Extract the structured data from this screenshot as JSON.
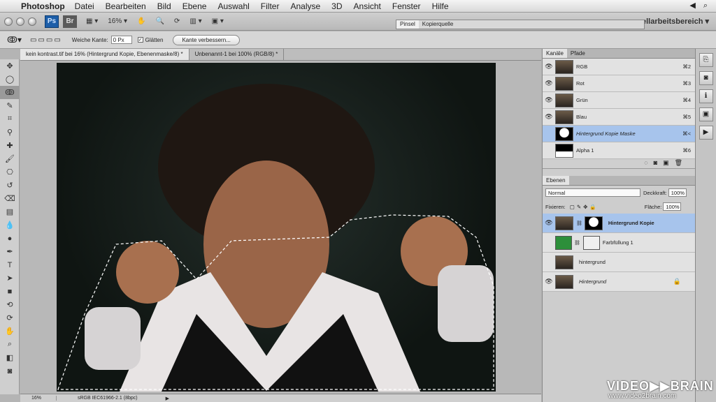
{
  "menubar": {
    "app_name": "Photoshop",
    "items": [
      "Datei",
      "Bearbeiten",
      "Bild",
      "Ebene",
      "Auswahl",
      "Filter",
      "Analyse",
      "3D",
      "Ansicht",
      "Fenster",
      "Hilfe"
    ]
  },
  "appbar": {
    "zoom": "16%",
    "workspace": "ellarbeitsbereich"
  },
  "floating_panel": {
    "tabs": [
      "Pinsel",
      "Kopierquelle"
    ]
  },
  "options": {
    "feather_label": "Weiche Kante:",
    "feather_value": "0 Px",
    "smooth_label": "Glätten",
    "refine_label": "Kante verbessern..."
  },
  "documents": {
    "tabs": [
      "kein kontrast.tif bei 16% (Hintergrund Kopie, Ebenenmaske/8) *",
      "Unbenannt-1 bei 100% (RGB/8) *"
    ]
  },
  "status": {
    "zoom": "16%",
    "profile": "sRGB IEC61966-2.1 (8bpc)"
  },
  "channels_panel": {
    "tabs": [
      "Kanäle",
      "Pfade"
    ],
    "rows": [
      {
        "name": "RGB",
        "key": "⌘2"
      },
      {
        "name": "Rot",
        "key": "⌘3"
      },
      {
        "name": "Grün",
        "key": "⌘4"
      },
      {
        "name": "Blau",
        "key": "⌘5"
      },
      {
        "name": "Hintergrund Kopie Maske",
        "key": "⌘<"
      },
      {
        "name": "Alpha 1",
        "key": "⌘6"
      }
    ]
  },
  "layers_panel": {
    "tab": "Ebenen",
    "blend_mode": "Normal",
    "opacity_label": "Deckkraft:",
    "opacity_value": "100%",
    "lock_label": "Fixieren:",
    "fill_label": "Fläche:",
    "fill_value": "100%",
    "layers": [
      {
        "name": "Hintergrund Kopie"
      },
      {
        "name": "Farbfüllung 1"
      },
      {
        "name": "hintergrund"
      },
      {
        "name": "Hintergrund"
      }
    ]
  },
  "watermark": {
    "brand": "VIDEO▶▶BRAIN",
    "url": "www.video2brain.com"
  },
  "colors": {
    "selection": "#a7c4ec",
    "fill_layer": "#2d8f3a",
    "ps_blue": "#1d5ea8"
  }
}
